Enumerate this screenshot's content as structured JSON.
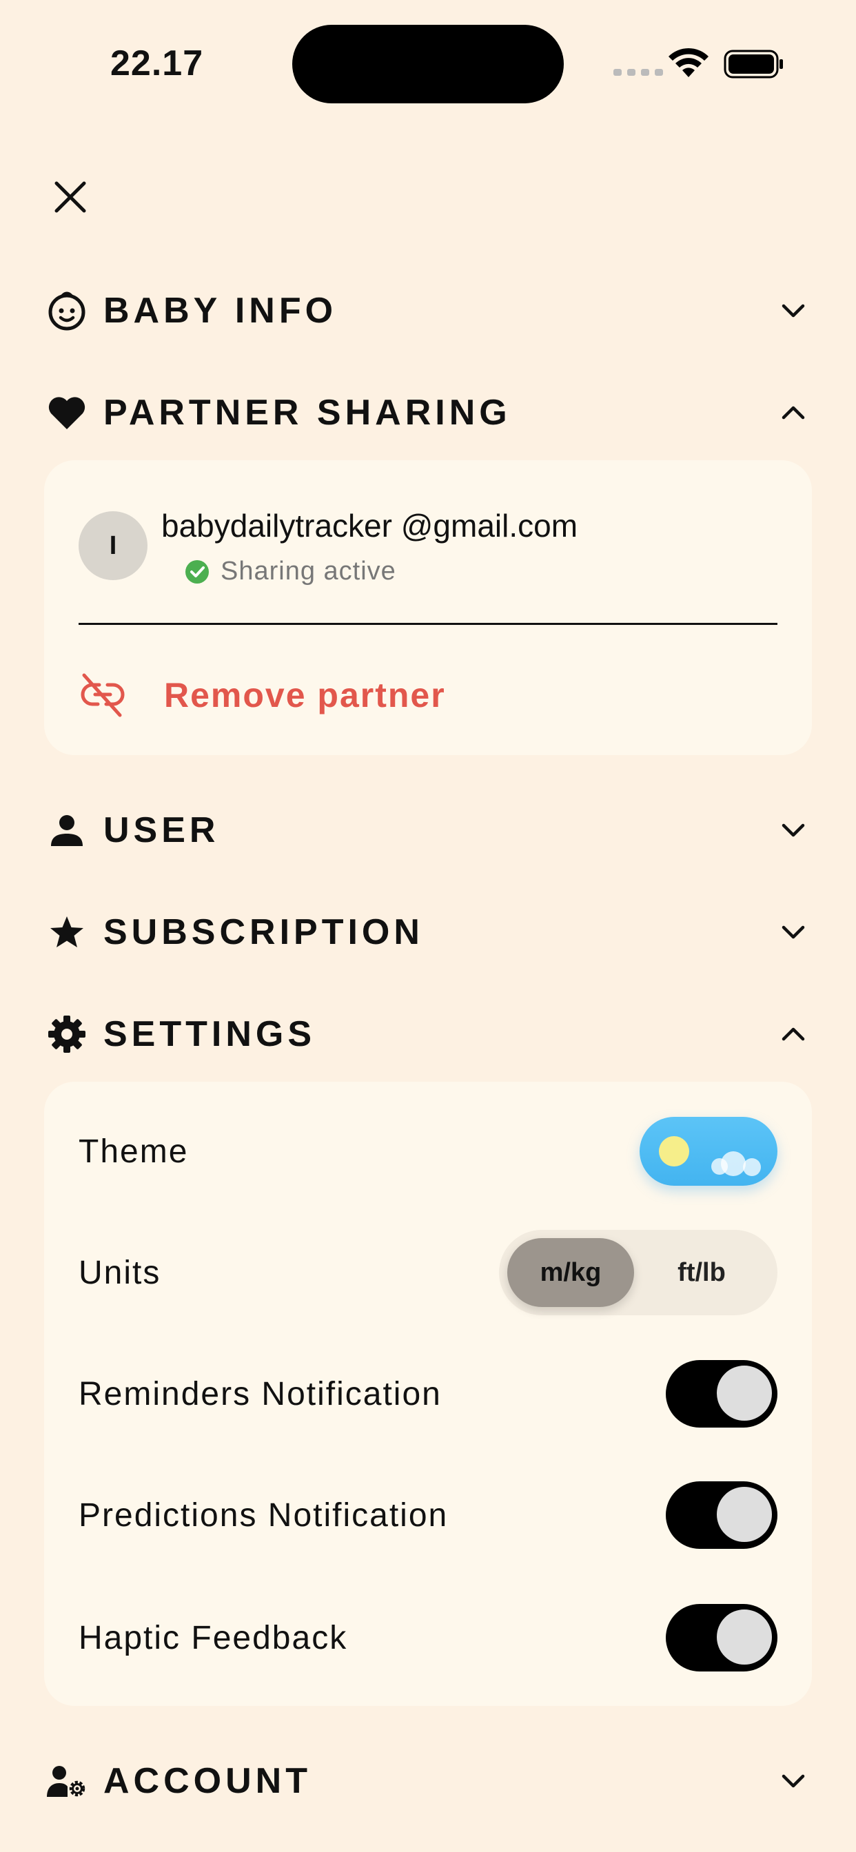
{
  "status_bar": {
    "time": "22.17"
  },
  "sections": {
    "baby_info": {
      "title": "BABY INFO",
      "icon": "baby-face-icon",
      "expanded": false
    },
    "partner_sharing": {
      "title": "PARTNER SHARING",
      "icon": "heart-icon",
      "expanded": true
    },
    "user": {
      "title": "USER",
      "icon": "person-icon",
      "expanded": false
    },
    "subscription": {
      "title": "SUBSCRIPTION",
      "icon": "star-icon",
      "expanded": false
    },
    "settings": {
      "title": "SETTINGS",
      "icon": "gear-icon",
      "expanded": true
    },
    "account": {
      "title": "ACCOUNT",
      "icon": "user-gear-icon",
      "expanded": false
    }
  },
  "partner": {
    "avatar_initial": "I",
    "email": "babydailytracker @gmail.com",
    "status": "Sharing active",
    "remove_label": "Remove partner"
  },
  "settings": {
    "theme": {
      "label": "Theme",
      "mode": "light"
    },
    "units": {
      "label": "Units",
      "options": [
        "m/kg",
        "ft/lb"
      ],
      "selected": "m/kg"
    },
    "reminders": {
      "label": "Reminders Notification",
      "enabled": true
    },
    "predictions": {
      "label": "Predictions Notification",
      "enabled": true
    },
    "haptic": {
      "label": "Haptic Feedback",
      "enabled": true
    }
  },
  "colors": {
    "background": "#FDF1E2",
    "card": "#FEF8EC",
    "danger": "#E2574C",
    "success": "#4CAF50",
    "theme_toggle": "#4DBBF4"
  }
}
